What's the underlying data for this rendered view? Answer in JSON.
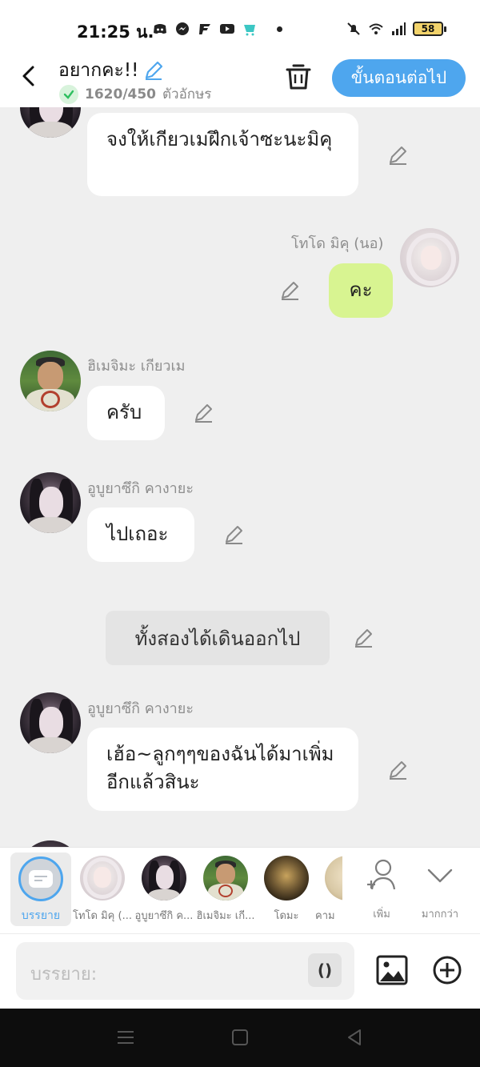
{
  "status_bar": {
    "time": "21:25 น.",
    "battery": "58"
  },
  "header": {
    "title": "อยากคะ!!",
    "char_count": "1620/450",
    "char_unit": "ตัวอักษร",
    "next_label": "ขั้นตอนต่อไป"
  },
  "messages": [
    {
      "text": "จงให้เกียวเมฝึกเจ้าซะนะมิคุ"
    },
    {
      "sender": "โทโด มิคุ (นอ)",
      "text": "คะ"
    },
    {
      "sender": "ฮิเมจิมะ เกียวเม",
      "text": "ครับ"
    },
    {
      "sender": "อูบูยาซึกิ คางายะ",
      "text": "ไปเถอะ"
    },
    {
      "text": "ทั้งสองได้เดินออกไป"
    },
    {
      "sender": "อูบูยาซึกิ คางายะ",
      "text": "เฮ้อ~ลูกๆๆของฉันได้มาเพิ่มอีกแล้วสินะ"
    }
  ],
  "characters": {
    "narration": "บรรยาย",
    "items": [
      {
        "label": "โทโด มิคุ (..."
      },
      {
        "label": "อูบูยาซึกิ ค..."
      },
      {
        "label": "ฮิเมจิมะ เกี..."
      },
      {
        "label": "โดมะ"
      },
      {
        "label": "คาม"
      }
    ],
    "add_label": "เพิ่ม",
    "more_label": "มากกว่า"
  },
  "input": {
    "placeholder": "บรรยาย:",
    "paren_label": "()"
  },
  "colors": {
    "accent": "#4ea6ee",
    "self_bubble": "#d8f491",
    "chat_bg": "#efefef"
  }
}
